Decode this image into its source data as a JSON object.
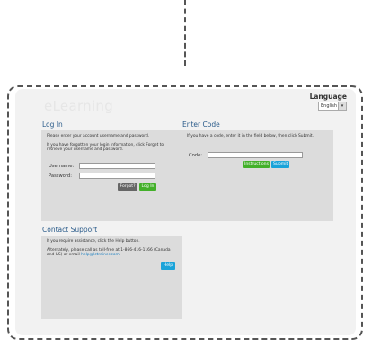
{
  "header": {
    "brand": "eLearning",
    "language_label": "Language",
    "language_value": "English"
  },
  "login": {
    "title": "Log In",
    "intro": "Please enter your account username and password.",
    "forgot_text": "If you have forgotten your login information, click Forget to retrieve your username and password.",
    "username_label": "Username:",
    "password_label": "Password:",
    "forgot_button": "Forgot?",
    "login_button": "Log In"
  },
  "code": {
    "title": "Enter Code",
    "intro": "If you have a code, enter it in the field below, then click Submit.",
    "code_label": "Code:",
    "instructions_button": "Instructions",
    "submit_button": "Submit"
  },
  "support": {
    "title": "Contact Support",
    "intro": "If you require assistance, click the Help button.",
    "alt_text": "Alternately, please call as toll-free at 1-866-416-1166 (Canada and US) or email",
    "email": "help@lctrainer.com",
    "help_button": "Help"
  },
  "colors": {
    "title_blue": "#2a5b8a",
    "green": "#43b02a",
    "blue": "#1aa3d9",
    "panel_bg": "#dcdcdc"
  }
}
